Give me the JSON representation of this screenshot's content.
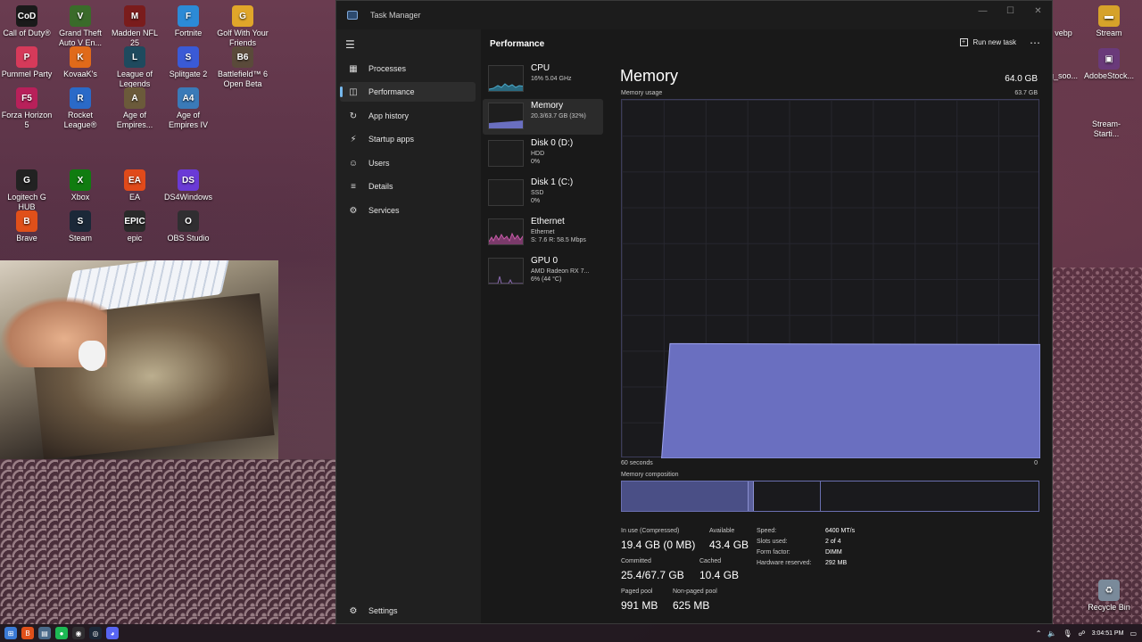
{
  "desktop_icons": [
    {
      "label": "Call of Duty®",
      "badge": "CoD",
      "color": "#1a1a1a"
    },
    {
      "label": "Grand Theft Auto V En...",
      "badge": "V",
      "color": "#3a6b2a"
    },
    {
      "label": "Madden NFL 25",
      "badge": "M",
      "color": "#7a1c1c"
    },
    {
      "label": "Fortnite",
      "badge": "F",
      "color": "#2c8ad6"
    },
    {
      "label": "Golf With Your Friends",
      "badge": "G",
      "color": "#e0a62a"
    },
    {
      "label": "Pummel Party",
      "badge": "P",
      "color": "#d63a5a"
    },
    {
      "label": "KovaaK's",
      "badge": "K",
      "color": "#e06a1a"
    },
    {
      "label": "League of Legends",
      "badge": "L",
      "color": "#1e4a5e"
    },
    {
      "label": "Splitgate 2",
      "badge": "S",
      "color": "#3a5ad6"
    },
    {
      "label": "Battlefield™ 6 Open Beta",
      "badge": "B6",
      "color": "#5a4a3a"
    },
    {
      "label": "Forza Horizon 5",
      "badge": "F5",
      "color": "#b8205a"
    },
    {
      "label": "Rocket League®",
      "badge": "R",
      "color": "#2a6ac8"
    },
    {
      "label": "Age of Empires...",
      "badge": "A",
      "color": "#6b5a3a"
    },
    {
      "label": "Age of Empires IV",
      "badge": "A4",
      "color": "#3a7ab8"
    },
    {
      "label": "Logitech G HUB",
      "badge": "G",
      "color": "#222"
    },
    {
      "label": "Xbox",
      "badge": "X",
      "color": "#107c10"
    },
    {
      "label": "EA",
      "badge": "EA",
      "color": "#e04a1a"
    },
    {
      "label": "DS4Windows",
      "badge": "DS",
      "color": "#6a3ad6"
    },
    {
      "label": "Brave",
      "badge": "B",
      "color": "#e0501a"
    },
    {
      "label": "Steam",
      "badge": "S",
      "color": "#1b2838"
    },
    {
      "label": "epic",
      "badge": "EPIC",
      "color": "#2a2a2a"
    },
    {
      "label": "OBS Studio",
      "badge": "O",
      "color": "#302e31"
    }
  ],
  "right_icons": [
    {
      "label": "vebp"
    },
    {
      "label": "Stream"
    },
    {
      "label": "g_soo..."
    },
    {
      "label": "AdobeStock..."
    },
    {
      "label": "Stream-Starti..."
    },
    {
      "label": "Recycle Bin"
    }
  ],
  "window": {
    "title": "Task Manager",
    "min": "—",
    "max": "☐",
    "close": "✕"
  },
  "nav": {
    "items": [
      {
        "label": "Processes",
        "icon": "▦"
      },
      {
        "label": "Performance",
        "icon": "◫"
      },
      {
        "label": "App history",
        "icon": "↻"
      },
      {
        "label": "Startup apps",
        "icon": "⚡"
      },
      {
        "label": "Users",
        "icon": "☺"
      },
      {
        "label": "Details",
        "icon": "≡"
      },
      {
        "label": "Services",
        "icon": "⚙"
      }
    ],
    "settings": "Settings"
  },
  "header": {
    "title": "Performance",
    "run_new_task": "Run new task"
  },
  "devices": [
    {
      "name": "CPU",
      "line1": "16% 5.04 GHz",
      "line2": ""
    },
    {
      "name": "Memory",
      "line1": "20.3/63.7 GB (32%)",
      "line2": ""
    },
    {
      "name": "Disk 0 (D:)",
      "line1": "HDD",
      "line2": "0%"
    },
    {
      "name": "Disk 1 (C:)",
      "line1": "SSD",
      "line2": "0%"
    },
    {
      "name": "Ethernet",
      "line1": "Ethernet",
      "line2": "S: 7.6 R: 58.5 Mbps"
    },
    {
      "name": "GPU 0",
      "line1": "AMD Radeon RX 7...",
      "line2": "6% (44 °C)"
    }
  ],
  "memory": {
    "title": "Memory",
    "total": "64.0 GB",
    "usage_label": "Memory usage",
    "max_label": "63.7 GB",
    "graph_left": "60 seconds",
    "graph_right": "0",
    "composition_label": "Memory composition",
    "usage_fraction": 0.32,
    "composition": {
      "in_use": 0.305,
      "modified": 0.012,
      "standby": 0.16
    },
    "stats": {
      "in_use_label": "In use (Compressed)",
      "in_use": "19.4 GB (0 MB)",
      "available_label": "Available",
      "available": "43.4 GB",
      "committed_label": "Committed",
      "committed": "25.4/67.7 GB",
      "cached_label": "Cached",
      "cached": "10.4 GB",
      "paged_label": "Paged pool",
      "paged": "991 MB",
      "nonpaged_label": "Non-paged pool",
      "nonpaged": "625 MB"
    },
    "specs": {
      "speed_label": "Speed:",
      "speed": "6400 MT/s",
      "slots_label": "Slots used:",
      "slots": "2 of 4",
      "form_label": "Form factor:",
      "form": "DIMM",
      "hw_label": "Hardware reserved:",
      "hw": "292 MB"
    }
  },
  "colors": {
    "memory_fill": "#6a6fc0",
    "memory_line": "#9ea4f0",
    "accent": "#76b9ed",
    "cpu": "#4aa8c8",
    "ethernet": "#c85aa8",
    "gpu": "#8a6ab0"
  },
  "taskbar": {
    "time": "3:04:51 PM"
  }
}
